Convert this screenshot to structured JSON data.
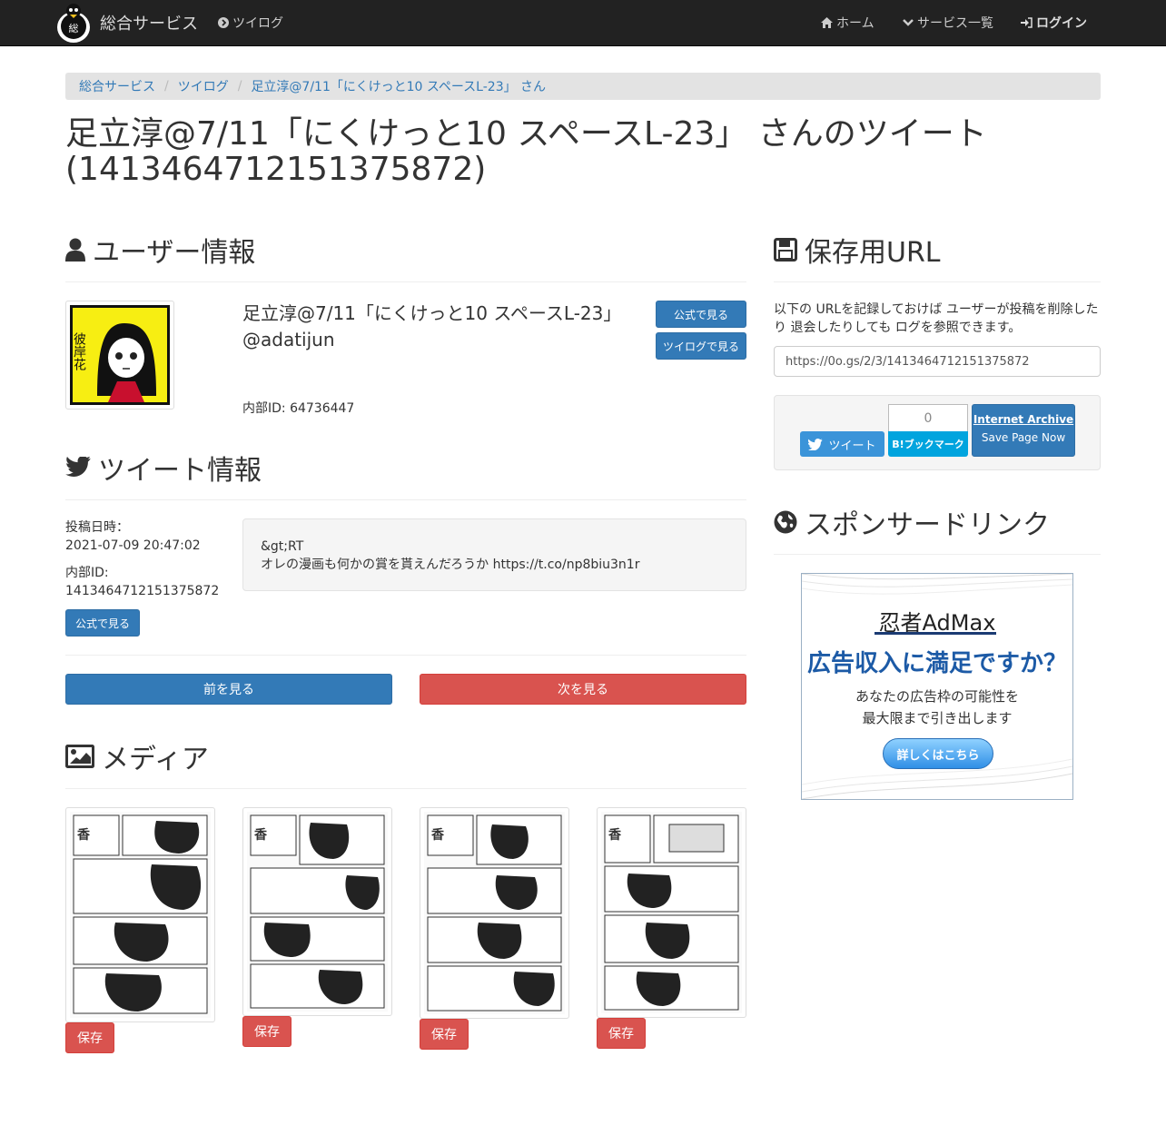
{
  "navbar": {
    "brand": "総合サービス",
    "tweelog": "ツイログ",
    "home": "ホーム",
    "services": "サービス一覧",
    "login": "ログイン"
  },
  "breadcrumb": [
    "総合サービス",
    "ツイログ",
    "足立淳@7/11「にくけっと10 スペースL-23」 さん"
  ],
  "page_title": "足立淳@7/11「にくけっと10 スペースL-23」 さんのツイート (1413464712151375872)",
  "user_section": {
    "heading": "ユーザー情報",
    "display_name": "足立淳@7/11「にくけっと10 スペースL-23」",
    "handle": "@adatijun",
    "internal_id": "内部ID: 64736447",
    "view_official": "公式で見る",
    "view_tweelog": "ツイログで見る",
    "avatar_text": "彼岸花"
  },
  "tweet_section": {
    "heading": "ツイート情報",
    "posted_label": "投稿日時：",
    "posted_value": "2021-07-09 20:47:02",
    "id_label": "内部ID:",
    "id_value": "1413464712151375872",
    "view_official": "公式で見る",
    "text_line1": "&gt;RT",
    "text_line2": "オレの漫画も何かの賞を貰えんだろうか https://t.co/np8biu3n1r",
    "prev": "前を見る",
    "next": "次を見る"
  },
  "media_section": {
    "heading": "メディア",
    "save_label": "保存"
  },
  "save_url": {
    "heading": "保存用URL",
    "description": "以下の URLを記録しておけば ユーザーが投稿を削除したり 退会したりしても ログを参照できます。",
    "url": "https://0o.gs/2/3/1413464712151375872",
    "tweet_button": "ツイート",
    "hatena_count": "0",
    "hatena_button": "B!ブックマーク",
    "ia_title": "Internet Archive",
    "ia_sub": "Save Page Now"
  },
  "sponsor": {
    "heading": "スポンサードリンク",
    "ad_logo": "忍者AdMax",
    "ad_head": "広告収入に満足ですか？",
    "ad_sub1": "あなたの広告枠の可能性を",
    "ad_sub2": "最大限まで引き出します",
    "ad_button": "詳しくはこちら"
  },
  "colors": {
    "navbar_bg": "#222222",
    "primary": "#337ab7",
    "danger": "#d9534f",
    "twitter": "#3b94d9",
    "hatena": "#00a4de"
  }
}
